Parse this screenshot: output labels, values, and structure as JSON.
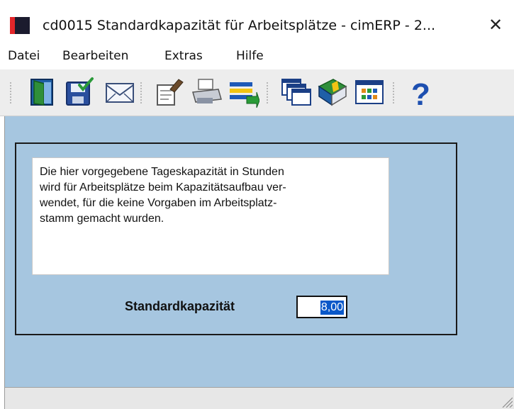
{
  "window": {
    "title": "cd0015 Standardkapazität für Arbeitsplätze - cimERP - 2...",
    "close_glyph": "✕"
  },
  "menu": {
    "items": [
      "Datei",
      "Bearbeiten",
      "Extras",
      "Hilfe"
    ]
  },
  "toolbar": {
    "icons": [
      "exit-door-icon",
      "save-disk-icon",
      "mail-envelope-icon",
      "edit-note-icon",
      "print-icon",
      "transfer-arrow-icon",
      "windows-icon",
      "book-icon",
      "calendar-grid-icon",
      "help-icon"
    ],
    "help_glyph": "?"
  },
  "content": {
    "info_text": "Die hier vorgegebene Tageskapazität in Stunden\nwird für Arbeitsplätze beim Kapazitätsaufbau ver-\nwendet, für die keine Vorgaben im Arbeitsplatz-\nstamm gemacht wurden.",
    "capacity_label": "Standardkapazität",
    "capacity_value": "8,00"
  },
  "colors": {
    "client_background": "#a6c6e0",
    "selection": "#0a58c9",
    "brand_red": "#e3262a"
  }
}
